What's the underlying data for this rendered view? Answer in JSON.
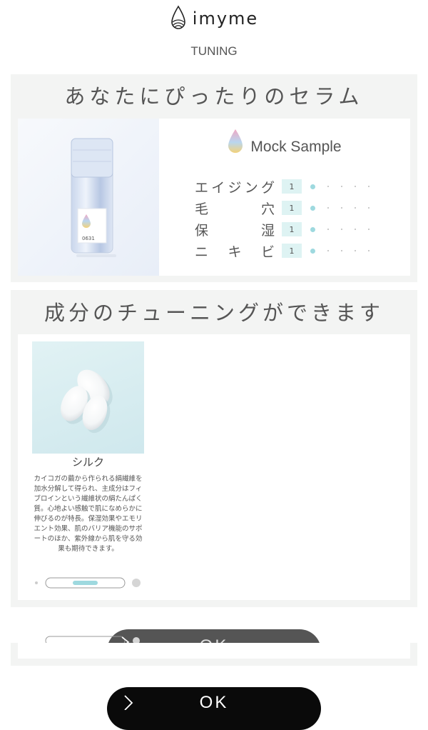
{
  "header": {
    "brand": "imyme",
    "subtitle": "TUNING"
  },
  "serum_panel": {
    "title": "あなたにぴったりのセラム",
    "bottle_label_code": "0631",
    "sample_name": "Mock Sample",
    "metrics": [
      {
        "label_chars": [
          "エ",
          "イ",
          "ジ",
          "ン",
          "グ"
        ],
        "value": "1",
        "level": 1,
        "max": 5
      },
      {
        "label_chars": [
          "毛",
          "穴"
        ],
        "value": "1",
        "level": 1,
        "max": 5
      },
      {
        "label_chars": [
          "保",
          "湿"
        ],
        "value": "1",
        "level": 1,
        "max": 5
      },
      {
        "label_chars": [
          "ニ",
          "キ",
          "ビ"
        ],
        "value": "1",
        "level": 1,
        "max": 5
      }
    ]
  },
  "ingredient_panel": {
    "title": "成分のチューニングができます",
    "ingredient": {
      "name": "シルク",
      "description": "カイコガの繭から作られる絹繊維を加水分解して得られ、主成分はフィブロインという繊維状の絹たんぱく質。心地よい感触で肌になめらかに伸びるのが特長。保湿効果やエモリエント効果、肌のバリア機能のサポートのほか、紫外線から肌を守る効果も期待できます。"
    }
  },
  "footer": {
    "ok_label": "OK",
    "ghost_ok_label": "OK"
  },
  "colors": {
    "panel_bg": "#f3f4f3",
    "accent_teal": "#9ed9df",
    "value_box": "#def3f3",
    "button_bg": "#0a0a0a"
  }
}
